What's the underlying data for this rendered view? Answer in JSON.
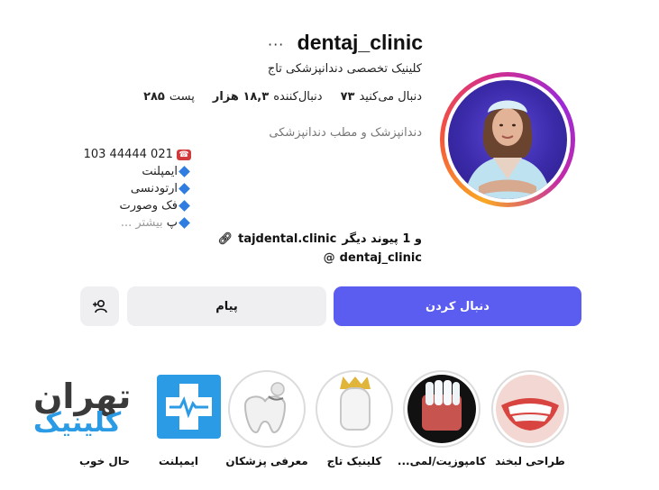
{
  "profile": {
    "username": "dentaj_clinic",
    "full_name": "کلینیک تخصصی دندانپزشکی تاج",
    "stats": {
      "posts_count": "۲۸۵",
      "posts_label": "پست",
      "followers_count": "۱۸,۳ هزار",
      "followers_label": "دنبال‌کننده",
      "following_count": "۷۳",
      "following_label": "دنبال می‌کنید"
    },
    "category": "دندانپزشک و مطب دندانپزشکی",
    "bio": {
      "phone": "103 44444 021",
      "line2": "ایمپلنت",
      "line3": "ارتودنسی",
      "line4": "فک وصورت",
      "line5_end": "پ",
      "more": "بیشتر ..."
    },
    "link_text": "tajdental.clinic",
    "link_more": "و 1 پیوند دیگر",
    "threads_handle": "dentaj_clinic"
  },
  "buttons": {
    "follow": "دنبال کردن",
    "message": "پیام",
    "suggest_icon": "add-person-icon"
  },
  "highlights": [
    {
      "label": "طراحی لبخند"
    },
    {
      "label": "کامپوزیت/لمی..."
    },
    {
      "label": "کلینیک تاج"
    },
    {
      "label": "معرفی پزشکان"
    },
    {
      "label": "ایمپلنت"
    },
    {
      "label": "حال خوب"
    }
  ],
  "watermark": {
    "line1": "تهران",
    "line2": "کلینیک"
  },
  "colors": {
    "follow_button": "#5b5cf0",
    "secondary_button": "#efeff2",
    "accent_blue": "#2b9be6"
  }
}
